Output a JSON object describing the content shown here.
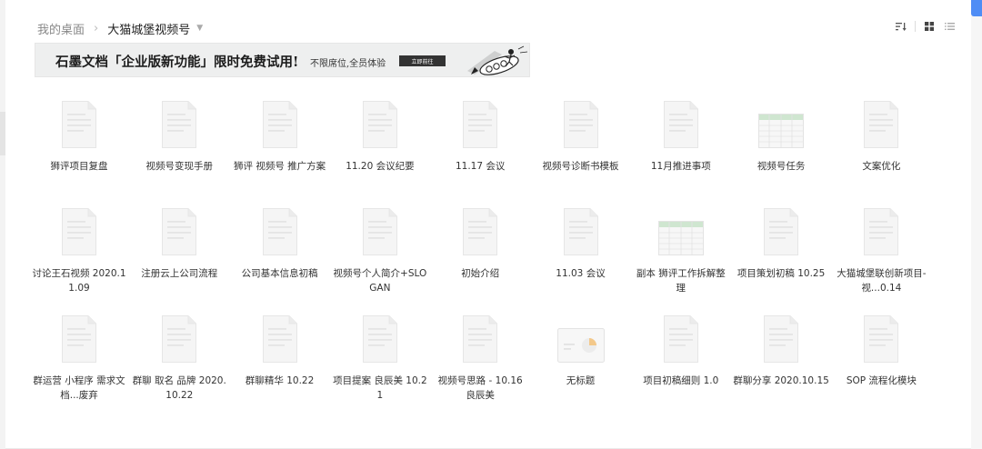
{
  "breadcrumb": {
    "root": "我的桌面",
    "separator": "›",
    "current": "大猫城堡视频号",
    "caret": "▼"
  },
  "toolbar": {
    "icons": [
      "sort-icon",
      "grid-view-icon",
      "list-view-icon"
    ]
  },
  "banner": {
    "title": "石墨文档「企业版新功能」限时免费试用!",
    "subtitle": "不限席位,全员体验",
    "cta": "立即前往"
  },
  "colors": {
    "accent": "#4f8df5",
    "sheet_header": "#cfe6d0",
    "doc_line": "#e6e6e6",
    "slide_chart": "#f3c88a"
  },
  "files": [
    {
      "name": "狮评项目复盘",
      "type": "doc"
    },
    {
      "name": "视频号变现手册",
      "type": "doc"
    },
    {
      "name": "狮评 视频号 推广方案",
      "type": "doc"
    },
    {
      "name": "11.20 会议纪要",
      "type": "doc"
    },
    {
      "name": "11.17 会议",
      "type": "doc"
    },
    {
      "name": "视频号诊断书模板",
      "type": "doc"
    },
    {
      "name": "11月推进事项",
      "type": "doc"
    },
    {
      "name": "视频号任务",
      "type": "sheet"
    },
    {
      "name": "文案优化",
      "type": "doc"
    },
    {
      "name": "讨论王石视频 2020.11.09",
      "type": "doc"
    },
    {
      "name": "注册云上公司流程",
      "type": "doc"
    },
    {
      "name": "公司基本信息初稿",
      "type": "doc"
    },
    {
      "name": "视频号个人简介+SLOGAN",
      "type": "doc"
    },
    {
      "name": "初始介绍",
      "type": "doc"
    },
    {
      "name": "11.03 会议",
      "type": "doc"
    },
    {
      "name": "副本 狮评工作拆解整理",
      "type": "sheet"
    },
    {
      "name": "项目策划初稿 10.25",
      "type": "doc"
    },
    {
      "name": "大猫城堡联创新项目-视...0.14",
      "type": "doc"
    },
    {
      "name": "群运营 小程序 需求文档...废弃",
      "type": "doc"
    },
    {
      "name": "群聊 取名 品牌 2020.10.22",
      "type": "doc"
    },
    {
      "name": "群聊精华 10.22",
      "type": "doc"
    },
    {
      "name": "项目提案 良辰美 10.21",
      "type": "doc"
    },
    {
      "name": "视频号思路 - 10.16 良辰美",
      "type": "doc"
    },
    {
      "name": "无标题",
      "type": "slide"
    },
    {
      "name": "项目初稿细则 1.0",
      "type": "doc"
    },
    {
      "name": "群聊分享 2020.10.15",
      "type": "doc"
    },
    {
      "name": "SOP 流程化模块",
      "type": "doc"
    }
  ]
}
